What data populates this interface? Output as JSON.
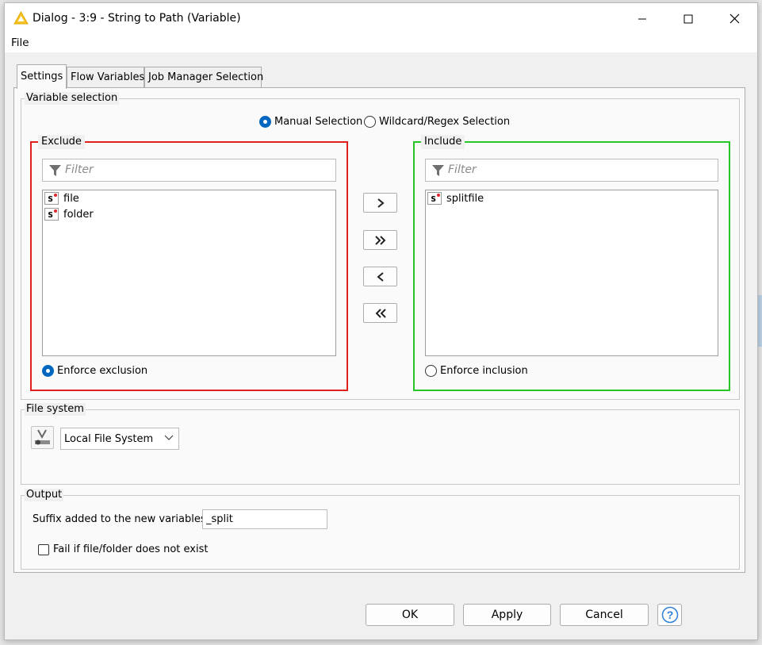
{
  "window": {
    "title": "Dialog - 3:9 - String to Path (Variable)",
    "minimize_icon": "minimize-icon",
    "maximize_icon": "maximize-icon",
    "close_icon": "close-icon"
  },
  "menubar": {
    "file": "File"
  },
  "tabs": [
    {
      "label": "Settings",
      "active": true
    },
    {
      "label": "Flow Variables",
      "active": false
    },
    {
      "label": "Job Manager Selection",
      "active": false
    }
  ],
  "variable_selection": {
    "group_label": "Variable selection",
    "mode_options": [
      {
        "label": "Manual Selection",
        "selected": true
      },
      {
        "label": "Wildcard/Regex Selection",
        "selected": false
      }
    ],
    "exclude": {
      "label": "Exclude",
      "border_color": "#e0201c",
      "filter_placeholder": "Filter",
      "items": [
        {
          "name": "file",
          "type": "s"
        },
        {
          "name": "folder",
          "type": "s"
        }
      ],
      "enforce_label": "Enforce exclusion",
      "enforce_selected": true
    },
    "include": {
      "label": "Include",
      "border_color": "#27c627",
      "filter_placeholder": "Filter",
      "items": [
        {
          "name": "splitfile",
          "type": "s"
        }
      ],
      "enforce_label": "Enforce inclusion",
      "enforce_selected": false
    },
    "move_buttons": {
      "add": ">",
      "add_all": "»",
      "remove": "<",
      "remove_all": "«"
    }
  },
  "file_system": {
    "group_label": "File system",
    "selected": "Local File System"
  },
  "output": {
    "group_label": "Output",
    "suffix_label": "Suffix added to the new variables:",
    "suffix_value": "_split",
    "fail_checkbox_label": "Fail if file/folder does not exist",
    "fail_checked": false
  },
  "buttons": {
    "ok": "OK",
    "apply": "Apply",
    "cancel": "Cancel",
    "help": "?"
  },
  "colors": {
    "accent": "#0067c0",
    "exclude_border": "#e0201c",
    "include_border": "#27c627"
  }
}
